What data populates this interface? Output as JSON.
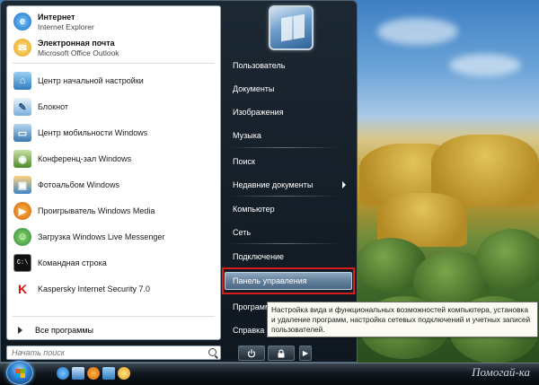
{
  "pinned": [
    {
      "title": "Интернет",
      "subtitle": "Internet Explorer",
      "icon": "internet-explorer-icon"
    },
    {
      "title": "Электронная почта",
      "subtitle": "Microsoft Office Outlook",
      "icon": "outlook-icon"
    }
  ],
  "programs": [
    {
      "label": "Центр начальной настройки",
      "icon": "welcome-center-icon"
    },
    {
      "label": "Блокнот",
      "icon": "notepad-icon"
    },
    {
      "label": "Центр мобильности Windows",
      "icon": "mobility-center-icon"
    },
    {
      "label": "Конференц-зал Windows",
      "icon": "meeting-space-icon"
    },
    {
      "label": "Фотоальбом Windows",
      "icon": "photo-gallery-icon"
    },
    {
      "label": "Проигрыватель Windows Media",
      "icon": "media-player-icon"
    },
    {
      "label": "Загрузка Windows Live Messenger",
      "icon": "messenger-icon"
    },
    {
      "label": "Командная строка",
      "icon": "cmd-icon"
    },
    {
      "label": "Kaspersky Internet Security 7.0",
      "icon": "kaspersky-icon"
    }
  ],
  "all_programs_label": "Все программы",
  "search": {
    "placeholder": "Начать поиск"
  },
  "right_items": {
    "user": "Пользователь",
    "documents": "Документы",
    "pictures": "Изображения",
    "music": "Музыка",
    "search": "Поиск",
    "recent": "Недавние документы",
    "computer": "Компьютер",
    "network": "Сеть",
    "connect": "Подключение",
    "control_panel": "Панель управления",
    "programs": "Программы по умолчанию",
    "help": "Справка и поддержка"
  },
  "tooltip": "Настройка вида и функциональных возможностей компьютера, установка и удаление программ, настройка сетевых подключений и учетных записей пользователей.",
  "watermark": "Помогай-ка",
  "colors": {
    "highlight": "#d91c1c",
    "tooltip_bg": "#fbfbf3"
  }
}
